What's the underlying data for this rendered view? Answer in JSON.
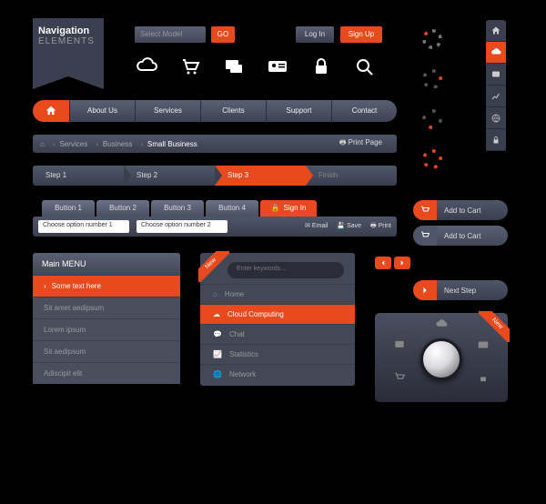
{
  "ribbon": {
    "line1": "Navigation",
    "line2": "ELEMENTS"
  },
  "select": {
    "placeholder": "Select Model"
  },
  "go": "GO",
  "login": "Log In",
  "signup": "Sign Up",
  "nav": [
    "About Us",
    "Services",
    "Clients",
    "Support",
    "Contact"
  ],
  "breadcrumb": {
    "items": [
      "Services",
      "Business"
    ],
    "current": "Small Business",
    "print": "Print Page"
  },
  "steps": [
    "Step 1",
    "Step 2",
    "Step 3",
    "Finish"
  ],
  "tabs": [
    "Button 1",
    "Button 2",
    "Button 3",
    "Button 4"
  ],
  "signin": "Sign In",
  "opt1": "Choose option number 1",
  "opt2": "Choose option number 2",
  "actions": {
    "email": "Email",
    "save": "Save",
    "print": "Print"
  },
  "mainmenu": {
    "title": "Main  MENU",
    "items": [
      "Some text here",
      "Sit amet aedipsum",
      "Lorem ipsum",
      "Sit aedipsum",
      "Adiscipit elit"
    ]
  },
  "panel": {
    "new": "New",
    "search": "Enter keywords...",
    "items": [
      "Home",
      "Cloud Computing",
      "Chat",
      "Statistics",
      "Network"
    ]
  },
  "cart1": "Add to Cart",
  "cart2": "Add to Cart",
  "next": "Next Step",
  "knob_new": "New"
}
